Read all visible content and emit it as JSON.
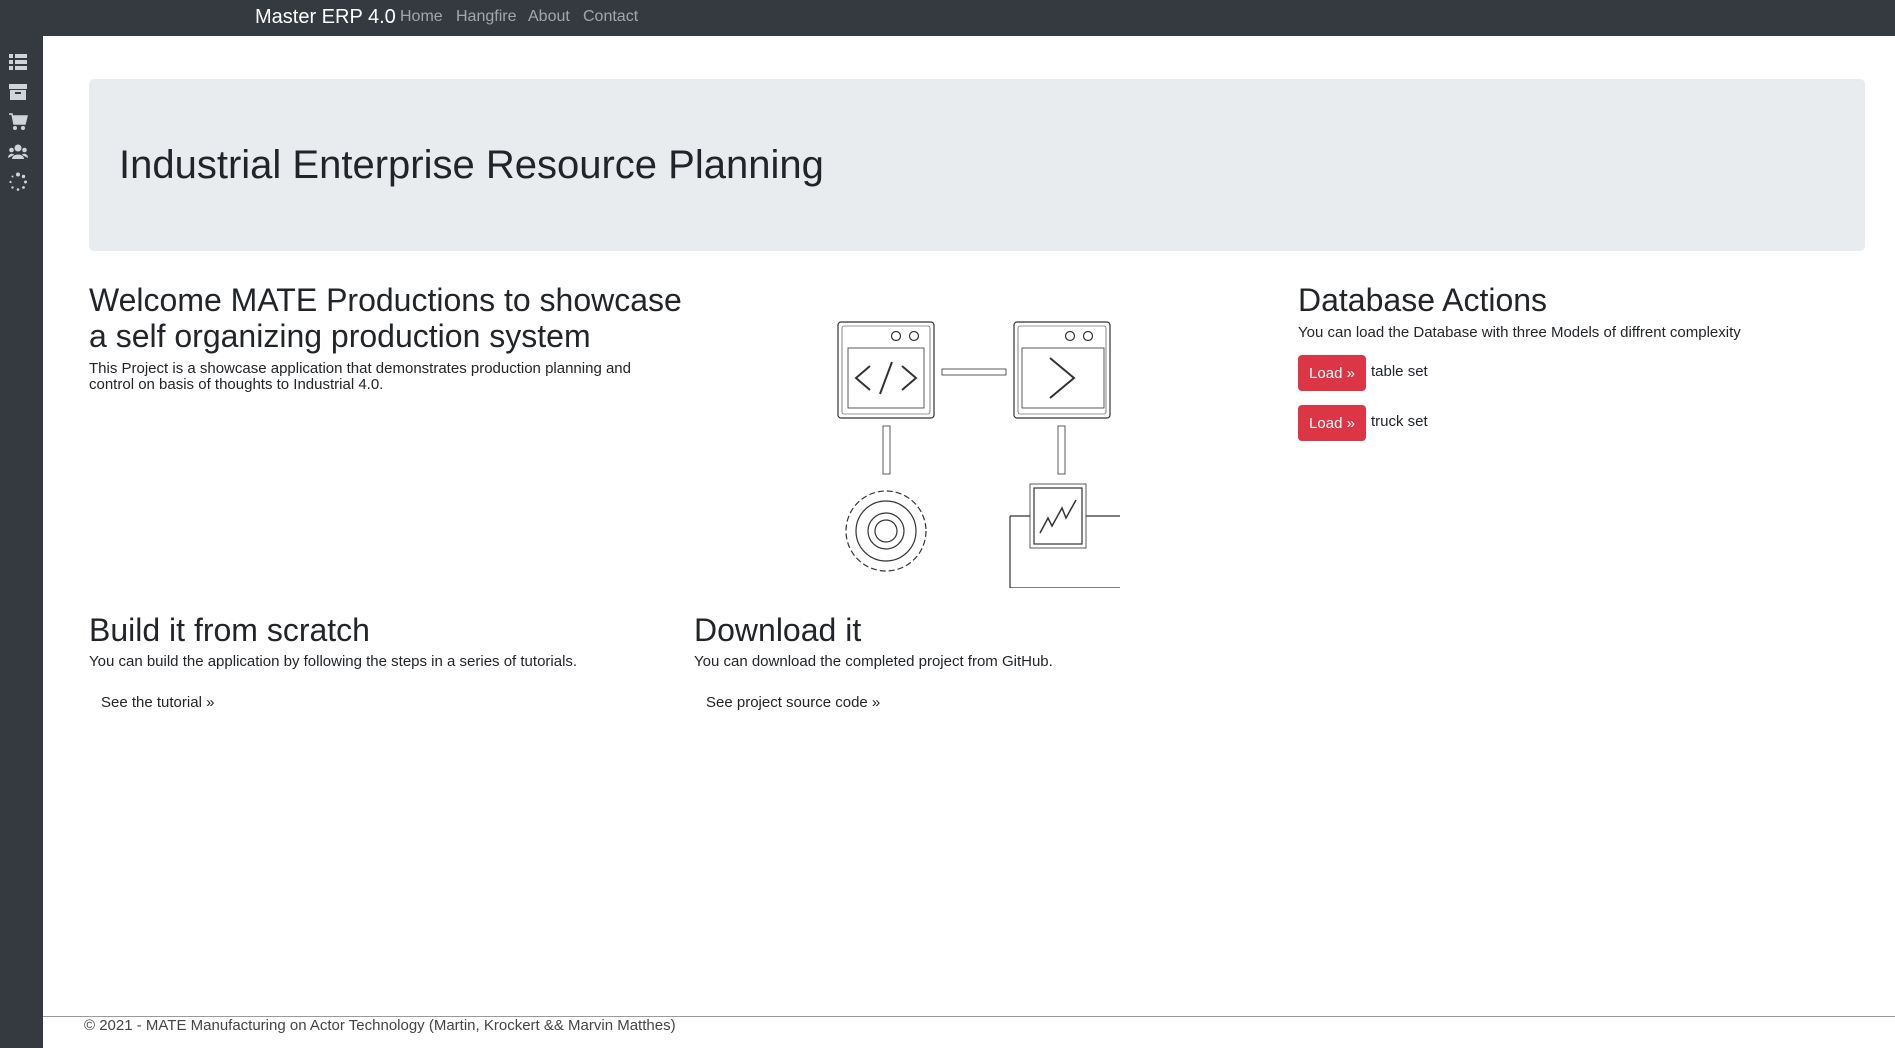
{
  "navbar": {
    "brand": "Master ERP 4.0",
    "links": [
      "Home",
      "Hangfire",
      "About",
      "Contact"
    ]
  },
  "sidebar": {
    "icons": [
      "list-icon",
      "archive-icon",
      "cart-icon",
      "users-icon",
      "spinner-icon"
    ]
  },
  "jumbotron": {
    "title": "Industrial Enterprise Resource Planning"
  },
  "welcome": {
    "title_line1": "Welcome MATE Productions to showcase",
    "title_line2": "a self organizing production system",
    "text_line1": "This Project is a showcase application that demonstrates production planning and",
    "text_line2": "control on basis of thoughts to Industrial 4.0."
  },
  "database": {
    "title": "Database Actions",
    "text": "You can load the Database with three Models of diffrent complexity",
    "actions": [
      {
        "button": "Load »",
        "label": "table set"
      },
      {
        "button": "Load »",
        "label": "truck set"
      }
    ]
  },
  "build": {
    "title": "Build it from scratch",
    "text": "You can build the application by following the steps in a series of tutorials.",
    "link": "See the tutorial »"
  },
  "download": {
    "title": "Download it",
    "text": "You can download the completed project from GitHub.",
    "link": "See project source code »"
  },
  "footer": {
    "text": "© 2021 - MATE Manufacturing on Actor Technology (Martin, Krockert && Marvin Matthes)"
  },
  "colors": {
    "navbar": "#343a40",
    "jumbotron": "#e9ecef",
    "danger": "#dc3545"
  }
}
